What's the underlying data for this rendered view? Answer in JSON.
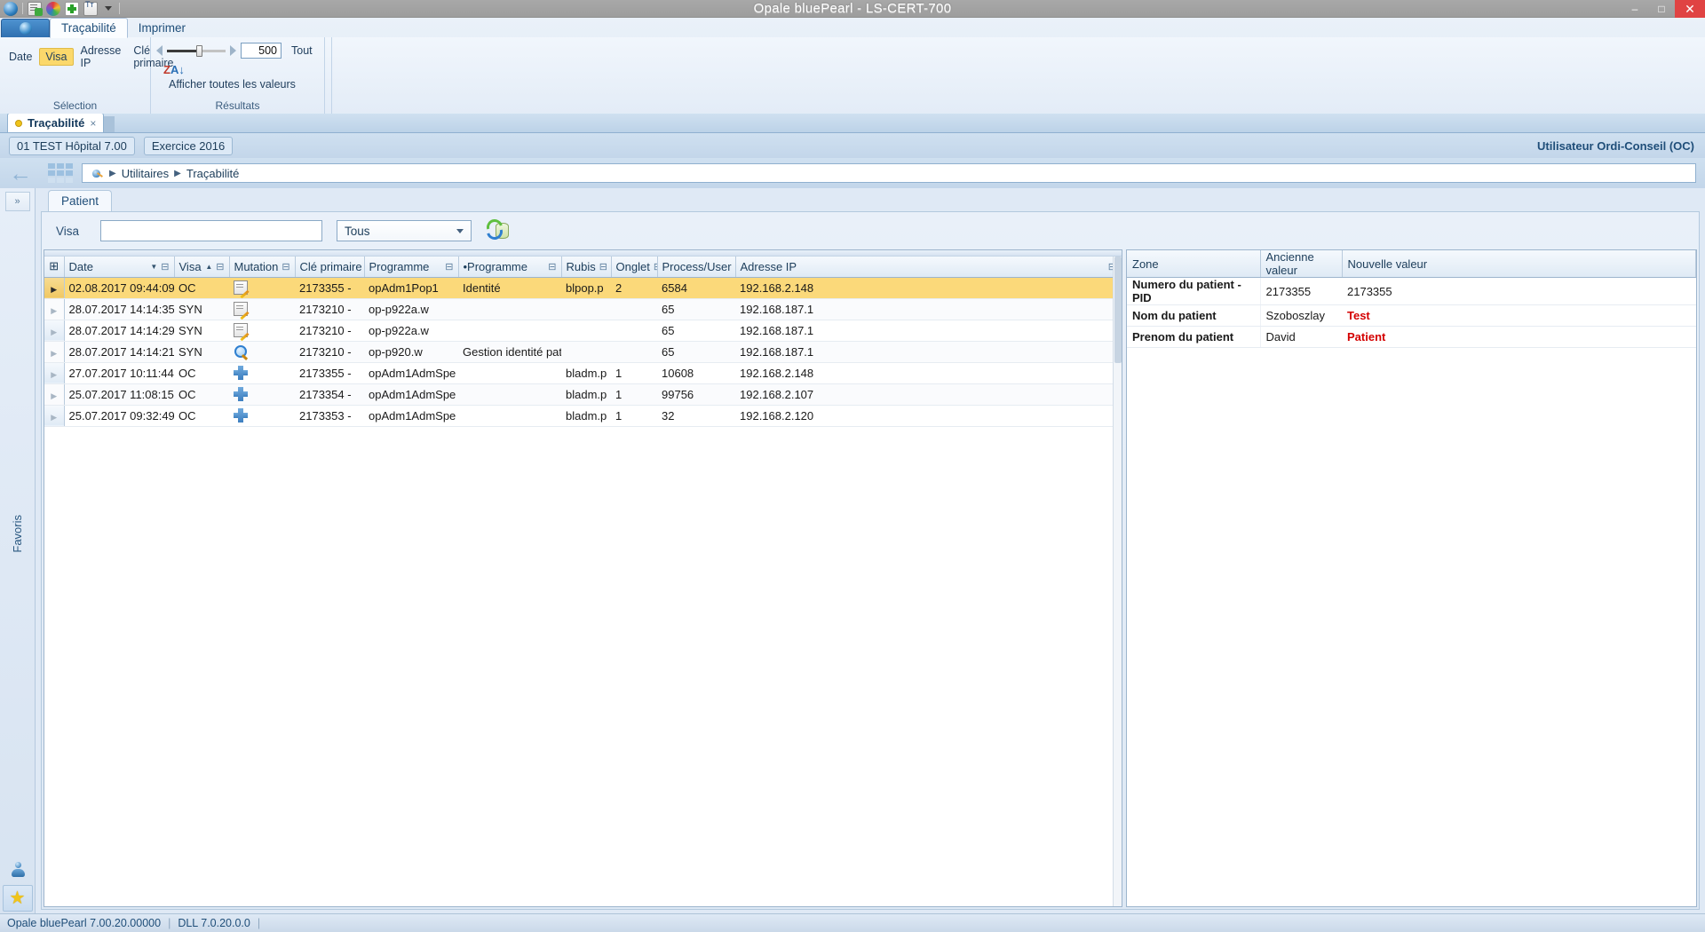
{
  "window": {
    "title": "Opale bluePearl   -   LS-CERT-700",
    "minimize": "–",
    "maximize": "□",
    "close": "✕",
    "quick_access": [
      "globe-icon",
      "new-document-icon",
      "color-wheel-icon",
      "move-icon",
      "text-format-icon",
      "customize-caret-icon"
    ]
  },
  "ribbon": {
    "app_button": "app-globe-button",
    "tabs": [
      {
        "label": "Traçabilité",
        "active": true
      },
      {
        "label": "Imprimer",
        "active": false
      }
    ],
    "groups": [
      {
        "name": "selection",
        "label": "Sélection",
        "chips": [
          {
            "label": "Date",
            "selected": false
          },
          {
            "label": "Visa",
            "selected": true
          },
          {
            "label": "Adresse IP",
            "selected": false
          },
          {
            "label": "Clé primaire",
            "selected": false
          }
        ]
      },
      {
        "name": "results",
        "label": "Résultats",
        "count_value": "500",
        "all_label": "Tout",
        "show_all_values_label": "Afficher toutes les valeurs",
        "sort_icon_z": "Z",
        "sort_icon_a": "A",
        "sort_icon_arrow": "↓"
      }
    ]
  },
  "doctab": {
    "label": "Traçabilité",
    "close": "×"
  },
  "context": {
    "entity": "01 TEST Hôpital 7.00",
    "exercise": "Exercice 2016",
    "user": "Utilisateur Ordi-Conseil (OC)"
  },
  "breadcrumb": {
    "sep": "▶",
    "items": [
      "Utilitaires",
      "Traçabilité"
    ]
  },
  "left_rail": {
    "expand": "»",
    "label": "Favoris",
    "buttons": [
      "user-icon",
      "star-icon"
    ]
  },
  "tabs": [
    {
      "label": "Patient",
      "active": true
    }
  ],
  "filter": {
    "visa_label": "Visa",
    "visa_value": "",
    "visa_placeholder": "",
    "select_value": "Tous",
    "select_options": [
      "Tous"
    ],
    "refresh_icon": "refresh-database-icon"
  },
  "grid": {
    "columns": [
      {
        "key": "rowhdr",
        "label": "",
        "icon": "column-chooser-icon"
      },
      {
        "key": "date",
        "label": "Date",
        "sort": "▼",
        "filter": "⊟"
      },
      {
        "key": "visa",
        "label": "Visa",
        "sort": "▲",
        "filter": "⊟"
      },
      {
        "key": "mutation",
        "label": "Mutation",
        "sort": "",
        "filter": "⊟"
      },
      {
        "key": "cle",
        "label": "Clé primaire",
        "sort": "",
        "filter": "⊟"
      },
      {
        "key": "programme",
        "label": "Programme",
        "sort": "",
        "filter": "⊟"
      },
      {
        "key": "programme2",
        "label": "•Programme",
        "sort": "",
        "filter": "⊟"
      },
      {
        "key": "rubis",
        "label": "Rubis",
        "sort": "",
        "filter": "⊟"
      },
      {
        "key": "onglet",
        "label": "Onglet",
        "sort": "",
        "filter": "⊟"
      },
      {
        "key": "process",
        "label": "Process/User",
        "sort": "",
        "filter": "⊟"
      },
      {
        "key": "ip",
        "label": "Adresse IP",
        "sort": "",
        "filter": "⊟"
      }
    ],
    "rows": [
      {
        "selected": true,
        "date": "02.08.2017 09:44:09",
        "visa": "OC",
        "mutation_icon": "edit-icon",
        "cle": "2173355 -",
        "programme": "opAdm1Pop1",
        "programme2": "Identité",
        "rubis": "blpop.p",
        "onglet": "2",
        "process": "6584",
        "ip": "192.168.2.148"
      },
      {
        "selected": false,
        "date": "28.07.2017 14:14:35",
        "visa": "SYN",
        "mutation_icon": "edit-icon",
        "cle": "2173210 -",
        "programme": "op-p922a.w",
        "programme2": "",
        "rubis": "",
        "onglet": "",
        "process": "65",
        "ip": "192.168.187.1"
      },
      {
        "selected": false,
        "date": "28.07.2017 14:14:29",
        "visa": "SYN",
        "mutation_icon": "edit-icon",
        "cle": "2173210 -",
        "programme": "op-p922a.w",
        "programme2": "",
        "rubis": "",
        "onglet": "",
        "process": "65",
        "ip": "192.168.187.1"
      },
      {
        "selected": false,
        "date": "28.07.2017 14:14:21",
        "visa": "SYN",
        "mutation_icon": "search-icon",
        "cle": "2173210 -",
        "programme": "op-p920.w",
        "programme2": "Gestion identité patient",
        "rubis": "",
        "onglet": "",
        "process": "65",
        "ip": "192.168.187.1"
      },
      {
        "selected": false,
        "date": "27.07.2017 10:11:44",
        "visa": "OC",
        "mutation_icon": "add-icon",
        "cle": "2173355 -",
        "programme": "opAdm1AdmSpe",
        "programme2": "",
        "rubis": "bladm.p",
        "onglet": "1",
        "process": "10608",
        "ip": "192.168.2.148"
      },
      {
        "selected": false,
        "date": "25.07.2017 11:08:15",
        "visa": "OC",
        "mutation_icon": "add-icon",
        "cle": "2173354 -",
        "programme": "opAdm1AdmSpe",
        "programme2": "",
        "rubis": "bladm.p",
        "onglet": "1",
        "process": "99756",
        "ip": "192.168.2.107"
      },
      {
        "selected": false,
        "date": "25.07.2017 09:32:49",
        "visa": "OC",
        "mutation_icon": "add-icon",
        "cle": "2173353 -",
        "programme": "opAdm1AdmSpe",
        "programme2": "",
        "rubis": "bladm.p",
        "onglet": "1",
        "process": "32",
        "ip": "192.168.2.120"
      }
    ]
  },
  "detail": {
    "columns": [
      "Zone",
      "Ancienne valeur",
      "Nouvelle valeur"
    ],
    "rows": [
      {
        "zone": "Numero du patient - PID",
        "old": "2173355",
        "new": "2173355",
        "changed": false
      },
      {
        "zone": "Nom du patient",
        "old": "Szoboszlay",
        "new": "Test",
        "changed": true
      },
      {
        "zone": "Prenom du patient",
        "old": "David",
        "new": "Patient",
        "changed": true
      }
    ]
  },
  "status": {
    "app_version": "Opale bluePearl 7.00.20.00000",
    "dll_version": "DLL 7.0.20.0.0",
    "sep": "|"
  },
  "colors": {
    "accent": "#1f4e79",
    "selection": "#fbd97a",
    "changed_value": "#d40000",
    "chip_selected": "#fbd86b",
    "close_button": "#e04343"
  }
}
